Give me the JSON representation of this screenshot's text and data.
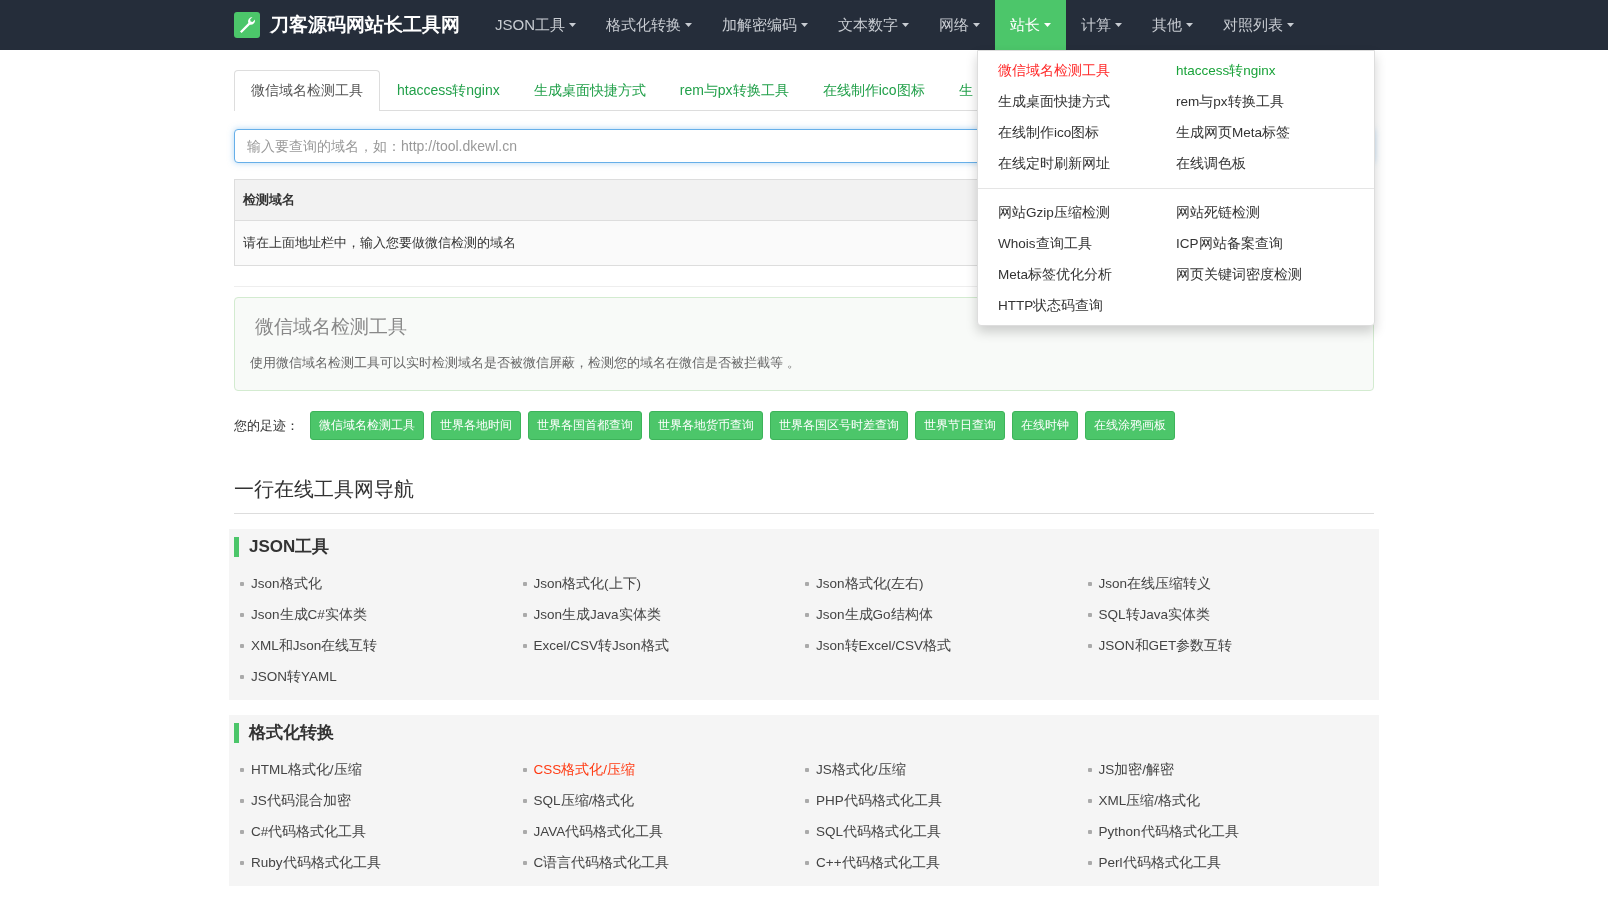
{
  "navbar": {
    "brand": "刀客源码网站长工具网",
    "items": [
      {
        "label": "JSON工具",
        "selected": false
      },
      {
        "label": "格式化转换",
        "selected": false
      },
      {
        "label": "加解密编码",
        "selected": false
      },
      {
        "label": "文本数字",
        "selected": false
      },
      {
        "label": "网络",
        "selected": false
      },
      {
        "label": "站长",
        "selected": true
      },
      {
        "label": "计算",
        "selected": false
      },
      {
        "label": "其他",
        "selected": false
      },
      {
        "label": "对照列表",
        "selected": false
      }
    ]
  },
  "dropdown": {
    "groups": [
      [
        {
          "label": "微信域名检测工具",
          "color": "#ff2a2a"
        },
        {
          "label": "htaccess转nginx",
          "color": "#1aa33a"
        },
        {
          "label": "生成桌面快捷方式",
          "color": "#333333"
        },
        {
          "label": "rem与px转换工具",
          "color": "#333333"
        },
        {
          "label": "在线制作ico图标",
          "color": "#333333"
        },
        {
          "label": "生成网页Meta标签",
          "color": "#333333"
        },
        {
          "label": "在线定时刷新网址",
          "color": "#333333"
        },
        {
          "label": "在线调色板",
          "color": "#333333"
        }
      ],
      [
        {
          "label": "网站Gzip压缩检测",
          "color": "#333333"
        },
        {
          "label": "网站死链检测",
          "color": "#333333"
        },
        {
          "label": "Whois查询工具",
          "color": "#333333"
        },
        {
          "label": "ICP网站备案查询",
          "color": "#333333"
        },
        {
          "label": "Meta标签优化分析",
          "color": "#333333"
        },
        {
          "label": "网页关键词密度检测",
          "color": "#333333"
        },
        {
          "label": "HTTP状态码查询",
          "color": "#333333"
        }
      ]
    ]
  },
  "tabs": [
    {
      "label": "微信域名检测工具",
      "selected": true
    },
    {
      "label": "htaccess转nginx",
      "selected": false
    },
    {
      "label": "生成桌面快捷方式",
      "selected": false
    },
    {
      "label": "rem与px转换工具",
      "selected": false
    },
    {
      "label": "在线制作ico图标",
      "selected": false
    },
    {
      "label": "生",
      "selected": false
    }
  ],
  "search": {
    "placeholder": "输入要查询的域名，如：http://tool.dkewl.cn"
  },
  "table": {
    "columns": [
      "检测域名"
    ],
    "rows": [
      [
        "请在上面地址栏中，输入您要做微信检测的域名"
      ]
    ]
  },
  "info": {
    "title": "微信域名检测工具",
    "description": "使用微信域名检测工具可以实时检测域名是否被微信屏蔽，检测您的域名在微信是否被拦截等 。"
  },
  "footprint": {
    "label": "您的足迹：",
    "tags": [
      "微信域名检测工具",
      "世界各地时间",
      "世界各国首都查询",
      "世界各地货币查询",
      "世界各国区号时差查询",
      "世界节日查询",
      "在线时钟",
      "在线涂鸦画板"
    ]
  },
  "nav_heading": "一行在线工具网导航",
  "sections": [
    {
      "title": "JSON工具",
      "links": [
        {
          "label": "Json格式化",
          "highlighted": false
        },
        {
          "label": "Json格式化(上下)",
          "highlighted": false
        },
        {
          "label": "Json格式化(左右)",
          "highlighted": false
        },
        {
          "label": "Json在线压缩转义",
          "highlighted": false
        },
        {
          "label": "Json生成C#实体类",
          "highlighted": false
        },
        {
          "label": "Json生成Java实体类",
          "highlighted": false
        },
        {
          "label": "Json生成Go结构体",
          "highlighted": false
        },
        {
          "label": "SQL转Java实体类",
          "highlighted": false
        },
        {
          "label": "XML和Json在线互转",
          "highlighted": false
        },
        {
          "label": "Excel/CSV转Json格式",
          "highlighted": false
        },
        {
          "label": "Json转Excel/CSV格式",
          "highlighted": false
        },
        {
          "label": "JSON和GET参数互转",
          "highlighted": false
        },
        {
          "label": "JSON转YAML",
          "highlighted": false
        }
      ]
    },
    {
      "title": "格式化转换",
      "links": [
        {
          "label": "HTML格式化/压缩",
          "highlighted": false
        },
        {
          "label": "CSS格式化/压缩",
          "highlighted": true
        },
        {
          "label": "JS格式化/压缩",
          "highlighted": false
        },
        {
          "label": "JS加密/解密",
          "highlighted": false
        },
        {
          "label": "JS代码混合加密",
          "highlighted": false
        },
        {
          "label": "SQL压缩/格式化",
          "highlighted": false
        },
        {
          "label": "PHP代码格式化工具",
          "highlighted": false
        },
        {
          "label": "XML压缩/格式化",
          "highlighted": false
        },
        {
          "label": "C#代码格式化工具",
          "highlighted": false
        },
        {
          "label": "JAVA代码格式化工具",
          "highlighted": false
        },
        {
          "label": "SQL代码格式化工具",
          "highlighted": false
        },
        {
          "label": "Python代码格式化工具",
          "highlighted": false
        },
        {
          "label": "Ruby代码格式化工具",
          "highlighted": false
        },
        {
          "label": "C语言代码格式化工具",
          "highlighted": false
        },
        {
          "label": "C++代码格式化工具",
          "highlighted": false
        },
        {
          "label": "Perl代码格式化工具",
          "highlighted": false
        }
      ]
    }
  ]
}
